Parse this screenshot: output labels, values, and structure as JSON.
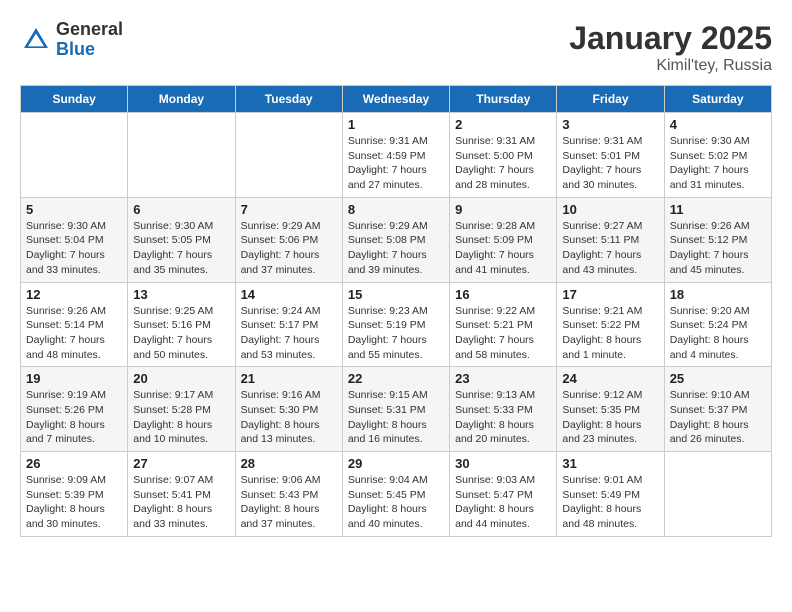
{
  "logo": {
    "general": "General",
    "blue": "Blue"
  },
  "title": "January 2025",
  "location": "Kimil'tey, Russia",
  "days_of_week": [
    "Sunday",
    "Monday",
    "Tuesday",
    "Wednesday",
    "Thursday",
    "Friday",
    "Saturday"
  ],
  "weeks": [
    [
      {
        "day": "",
        "info": ""
      },
      {
        "day": "",
        "info": ""
      },
      {
        "day": "",
        "info": ""
      },
      {
        "day": "1",
        "info": "Sunrise: 9:31 AM\nSunset: 4:59 PM\nDaylight: 7 hours and 27 minutes."
      },
      {
        "day": "2",
        "info": "Sunrise: 9:31 AM\nSunset: 5:00 PM\nDaylight: 7 hours and 28 minutes."
      },
      {
        "day": "3",
        "info": "Sunrise: 9:31 AM\nSunset: 5:01 PM\nDaylight: 7 hours and 30 minutes."
      },
      {
        "day": "4",
        "info": "Sunrise: 9:30 AM\nSunset: 5:02 PM\nDaylight: 7 hours and 31 minutes."
      }
    ],
    [
      {
        "day": "5",
        "info": "Sunrise: 9:30 AM\nSunset: 5:04 PM\nDaylight: 7 hours and 33 minutes."
      },
      {
        "day": "6",
        "info": "Sunrise: 9:30 AM\nSunset: 5:05 PM\nDaylight: 7 hours and 35 minutes."
      },
      {
        "day": "7",
        "info": "Sunrise: 9:29 AM\nSunset: 5:06 PM\nDaylight: 7 hours and 37 minutes."
      },
      {
        "day": "8",
        "info": "Sunrise: 9:29 AM\nSunset: 5:08 PM\nDaylight: 7 hours and 39 minutes."
      },
      {
        "day": "9",
        "info": "Sunrise: 9:28 AM\nSunset: 5:09 PM\nDaylight: 7 hours and 41 minutes."
      },
      {
        "day": "10",
        "info": "Sunrise: 9:27 AM\nSunset: 5:11 PM\nDaylight: 7 hours and 43 minutes."
      },
      {
        "day": "11",
        "info": "Sunrise: 9:26 AM\nSunset: 5:12 PM\nDaylight: 7 hours and 45 minutes."
      }
    ],
    [
      {
        "day": "12",
        "info": "Sunrise: 9:26 AM\nSunset: 5:14 PM\nDaylight: 7 hours and 48 minutes."
      },
      {
        "day": "13",
        "info": "Sunrise: 9:25 AM\nSunset: 5:16 PM\nDaylight: 7 hours and 50 minutes."
      },
      {
        "day": "14",
        "info": "Sunrise: 9:24 AM\nSunset: 5:17 PM\nDaylight: 7 hours and 53 minutes."
      },
      {
        "day": "15",
        "info": "Sunrise: 9:23 AM\nSunset: 5:19 PM\nDaylight: 7 hours and 55 minutes."
      },
      {
        "day": "16",
        "info": "Sunrise: 9:22 AM\nSunset: 5:21 PM\nDaylight: 7 hours and 58 minutes."
      },
      {
        "day": "17",
        "info": "Sunrise: 9:21 AM\nSunset: 5:22 PM\nDaylight: 8 hours and 1 minute."
      },
      {
        "day": "18",
        "info": "Sunrise: 9:20 AM\nSunset: 5:24 PM\nDaylight: 8 hours and 4 minutes."
      }
    ],
    [
      {
        "day": "19",
        "info": "Sunrise: 9:19 AM\nSunset: 5:26 PM\nDaylight: 8 hours and 7 minutes."
      },
      {
        "day": "20",
        "info": "Sunrise: 9:17 AM\nSunset: 5:28 PM\nDaylight: 8 hours and 10 minutes."
      },
      {
        "day": "21",
        "info": "Sunrise: 9:16 AM\nSunset: 5:30 PM\nDaylight: 8 hours and 13 minutes."
      },
      {
        "day": "22",
        "info": "Sunrise: 9:15 AM\nSunset: 5:31 PM\nDaylight: 8 hours and 16 minutes."
      },
      {
        "day": "23",
        "info": "Sunrise: 9:13 AM\nSunset: 5:33 PM\nDaylight: 8 hours and 20 minutes."
      },
      {
        "day": "24",
        "info": "Sunrise: 9:12 AM\nSunset: 5:35 PM\nDaylight: 8 hours and 23 minutes."
      },
      {
        "day": "25",
        "info": "Sunrise: 9:10 AM\nSunset: 5:37 PM\nDaylight: 8 hours and 26 minutes."
      }
    ],
    [
      {
        "day": "26",
        "info": "Sunrise: 9:09 AM\nSunset: 5:39 PM\nDaylight: 8 hours and 30 minutes."
      },
      {
        "day": "27",
        "info": "Sunrise: 9:07 AM\nSunset: 5:41 PM\nDaylight: 8 hours and 33 minutes."
      },
      {
        "day": "28",
        "info": "Sunrise: 9:06 AM\nSunset: 5:43 PM\nDaylight: 8 hours and 37 minutes."
      },
      {
        "day": "29",
        "info": "Sunrise: 9:04 AM\nSunset: 5:45 PM\nDaylight: 8 hours and 40 minutes."
      },
      {
        "day": "30",
        "info": "Sunrise: 9:03 AM\nSunset: 5:47 PM\nDaylight: 8 hours and 44 minutes."
      },
      {
        "day": "31",
        "info": "Sunrise: 9:01 AM\nSunset: 5:49 PM\nDaylight: 8 hours and 48 minutes."
      },
      {
        "day": "",
        "info": ""
      }
    ]
  ]
}
